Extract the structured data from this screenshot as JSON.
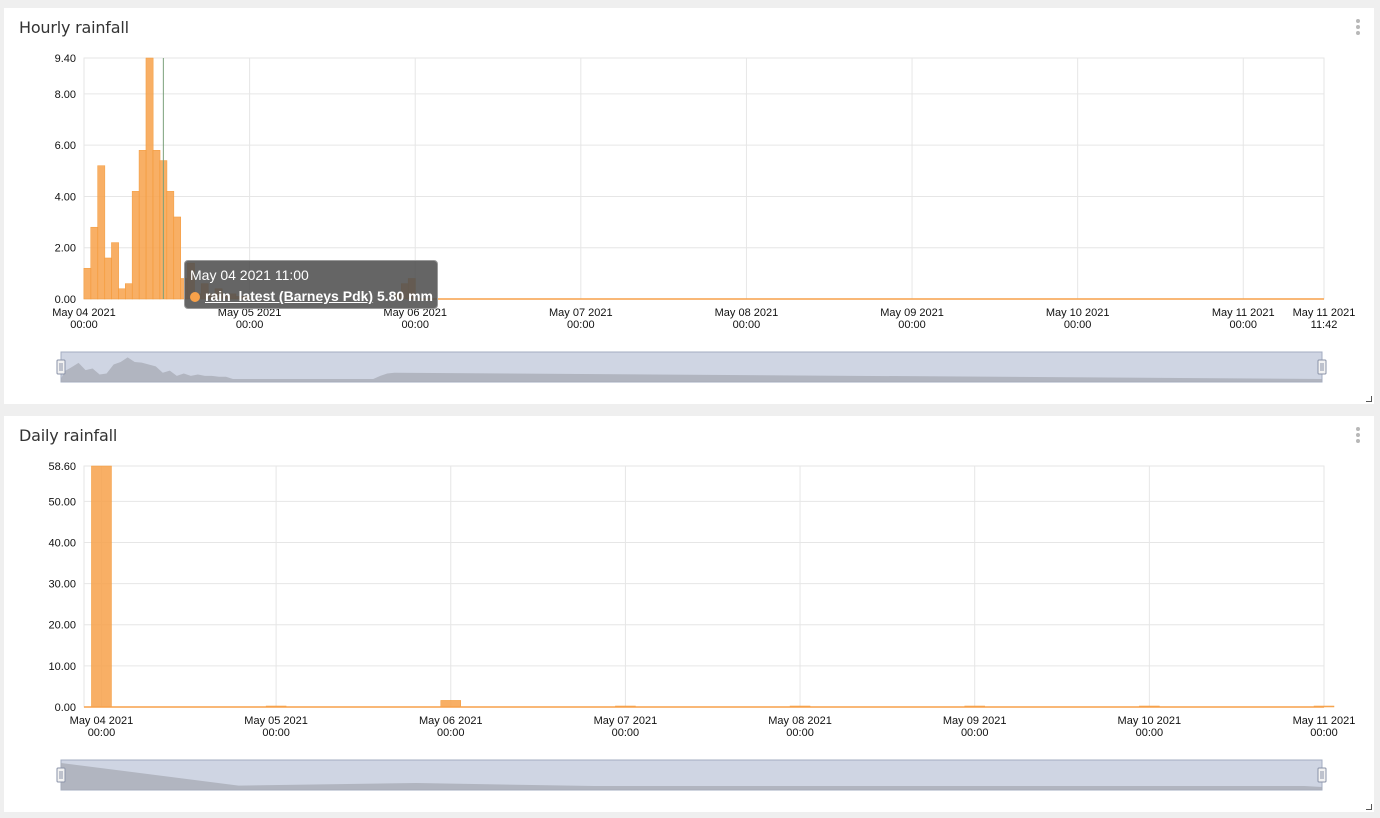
{
  "colors": {
    "bar": "#f7a14a",
    "bar_stroke": "#f39a3a",
    "grid": "#e6e6e6",
    "navigator_fill": "#cfd5e3",
    "navigator_area": "#a9adb6",
    "cursor_line": "#7aa07a"
  },
  "panels": [
    {
      "id": "hourly",
      "title": "Hourly rainfall"
    },
    {
      "id": "daily",
      "title": "Daily rainfall"
    }
  ],
  "tooltip": {
    "time": "May 04 2021 11:00",
    "series": "rain_latest (Barneys Pdk)",
    "value": "5.80 mm"
  },
  "chart_data": [
    {
      "type": "bar",
      "title": "Hourly rainfall",
      "unit": "hours since May 04 2021 00:00",
      "x_range": [
        0,
        179.7
      ],
      "ylim": [
        0,
        9.4
      ],
      "y_ticks": [
        0,
        2,
        4,
        6,
        8,
        9.4
      ],
      "y_tick_labels": [
        "0.00",
        "2.00",
        "4.00",
        "6.00",
        "8.00",
        "9.40"
      ],
      "x_ticks": [
        {
          "x": 0,
          "label": [
            "May 04 2021",
            "00:00"
          ]
        },
        {
          "x": 24,
          "label": [
            "May 05 2021",
            "00:00"
          ]
        },
        {
          "x": 48,
          "label": [
            "May 06 2021",
            "00:00"
          ]
        },
        {
          "x": 72,
          "label": [
            "May 07 2021",
            "00:00"
          ]
        },
        {
          "x": 96,
          "label": [
            "May 08 2021",
            "00:00"
          ]
        },
        {
          "x": 120,
          "label": [
            "May 09 2021",
            "00:00"
          ]
        },
        {
          "x": 144,
          "label": [
            "May 10 2021",
            "00:00"
          ]
        },
        {
          "x": 168,
          "label": [
            "May 11 2021",
            "00:00"
          ]
        },
        {
          "x": 179.7,
          "label": [
            "May 11 2021",
            "11:42"
          ]
        }
      ],
      "grid": true,
      "cursor_x": 11,
      "values": [
        1.2,
        2.8,
        5.2,
        1.6,
        2.2,
        0.4,
        0.6,
        4.2,
        5.8,
        9.4,
        5.8,
        5.4,
        4.2,
        3.2,
        0.8,
        1.4,
        0.2,
        0.6,
        0.2,
        0.4,
        0.2,
        0.2,
        0.1,
        0.1,
        0.0,
        0.0,
        0.0,
        0.0,
        0.0,
        0.0,
        0.0,
        0.0,
        0.0,
        0.0,
        0.0,
        0.0,
        0.0,
        0.0,
        0.0,
        0.0,
        0.0,
        0.0,
        0.0,
        0.0,
        0.0,
        0.2,
        0.6,
        0.8
      ],
      "navigator": true
    },
    {
      "type": "bar",
      "title": "Daily rainfall",
      "x_range": [
        -0.1,
        7.0
      ],
      "ylim": [
        0,
        58.6
      ],
      "y_ticks": [
        0,
        10,
        20,
        30,
        40,
        50,
        58.6
      ],
      "y_tick_labels": [
        "0.00",
        "10.00",
        "20.00",
        "30.00",
        "40.00",
        "50.00",
        "58.60"
      ],
      "x_ticks": [
        {
          "x": 0,
          "label": [
            "May 04 2021",
            "00:00"
          ]
        },
        {
          "x": 1,
          "label": [
            "May 05 2021",
            "00:00"
          ]
        },
        {
          "x": 2,
          "label": [
            "May 06 2021",
            "00:00"
          ]
        },
        {
          "x": 3,
          "label": [
            "May 07 2021",
            "00:00"
          ]
        },
        {
          "x": 4,
          "label": [
            "May 08 2021",
            "00:00"
          ]
        },
        {
          "x": 5,
          "label": [
            "May 09 2021",
            "00:00"
          ]
        },
        {
          "x": 6,
          "label": [
            "May 10 2021",
            "00:00"
          ]
        },
        {
          "x": 7,
          "label": [
            "May 11 2021",
            "00:00"
          ]
        }
      ],
      "grid": true,
      "values": [
        58.6,
        0.2,
        1.6,
        0.1,
        0.1,
        0.1,
        0.1,
        0.1
      ],
      "navigator": true
    }
  ]
}
